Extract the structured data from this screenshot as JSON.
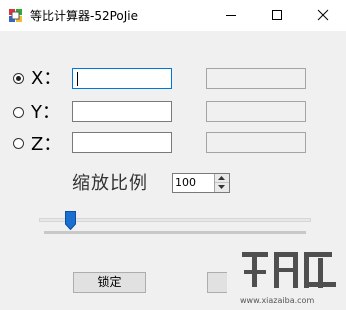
{
  "window": {
    "title": "等比计算器-52PoJie"
  },
  "axes": [
    {
      "label": "X：",
      "selected": true,
      "value": "",
      "result": ""
    },
    {
      "label": "Y：",
      "selected": false,
      "value": "",
      "result": ""
    },
    {
      "label": "Z：",
      "selected": false,
      "value": "",
      "result": ""
    }
  ],
  "scale": {
    "label": "缩放比例",
    "value": "100"
  },
  "slider": {
    "level": 0.1
  },
  "buttons": {
    "lock_label": "锁定"
  },
  "watermark": {
    "site": "www.xiazaiba.com"
  },
  "colors": {
    "accent": "#0078d7",
    "thumb": "#1a6fd1"
  },
  "icons": {
    "app": "app-icon",
    "minimize": "minimize-icon",
    "maximize": "maximize-icon",
    "close": "close-icon"
  }
}
